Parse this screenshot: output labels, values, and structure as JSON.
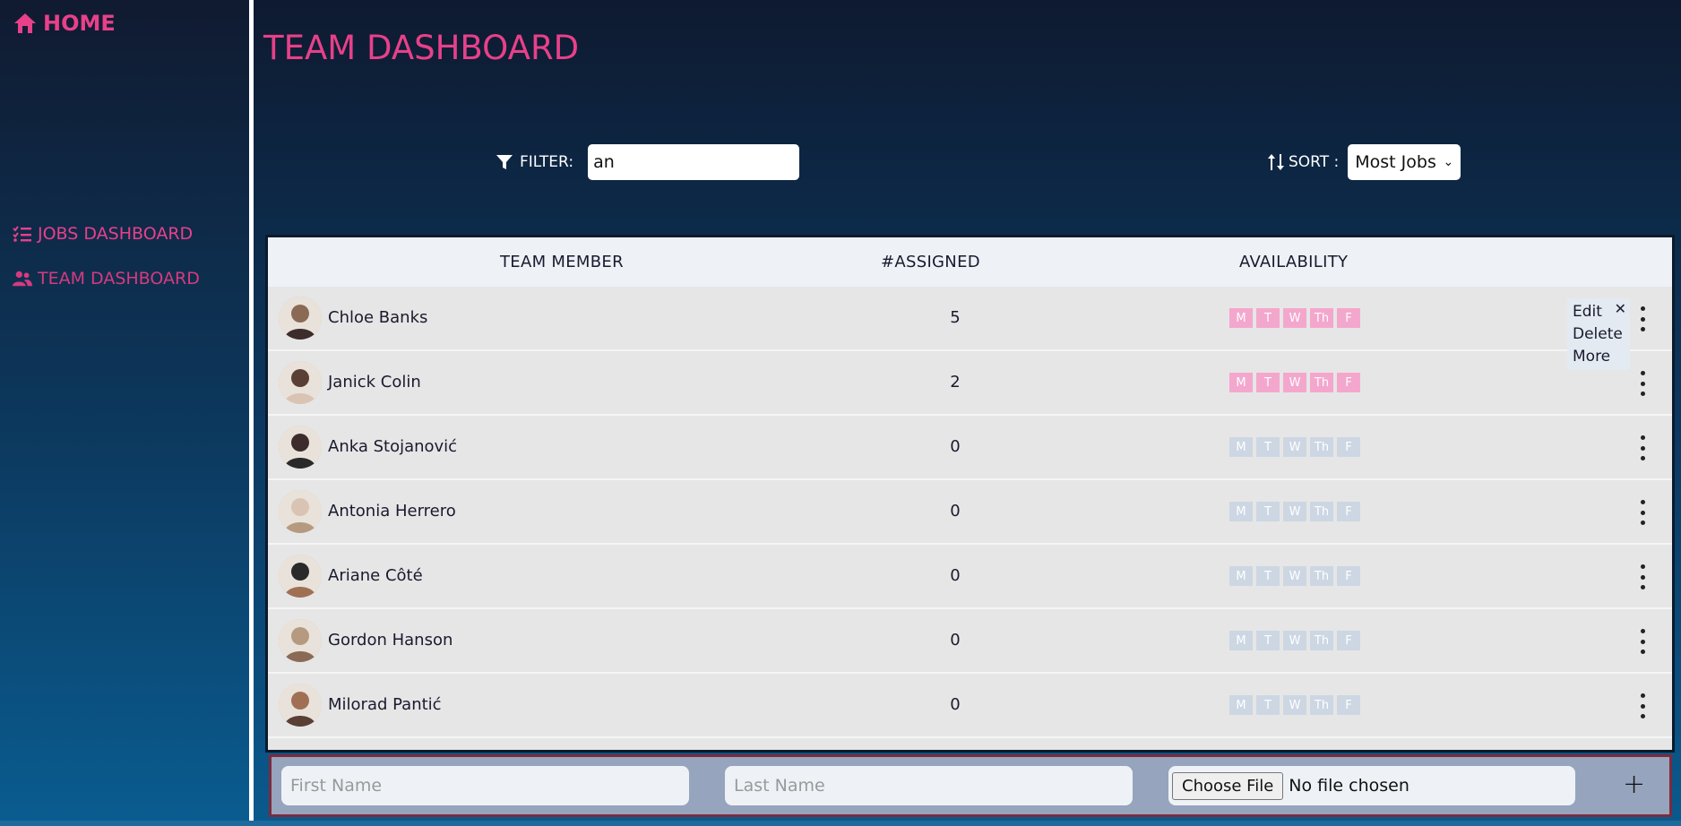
{
  "sidebar": {
    "home_label": "HOME",
    "nav": [
      {
        "label": "JOBS DASHBOARD",
        "icon": "list-check-icon"
      },
      {
        "label": "TEAM DASHBOARD",
        "icon": "users-icon"
      }
    ]
  },
  "header": {
    "title": "TEAM DASHBOARD",
    "filter_label": "FILTER:",
    "filter_value": "an",
    "sort_label": "SORT :",
    "sort_value": "Most Jobs"
  },
  "table": {
    "columns": [
      "TEAM MEMBER",
      "#ASSIGNED",
      "AVAILABILITY"
    ],
    "day_labels": [
      "M",
      "T",
      "W",
      "Th",
      "F"
    ],
    "rows": [
      {
        "name": "Chloe Banks",
        "assigned": "5",
        "available": true
      },
      {
        "name": "Janick Colin",
        "assigned": "2",
        "available": true
      },
      {
        "name": "Anka Stojanović",
        "assigned": "0",
        "available": false
      },
      {
        "name": "Antonia Herrero",
        "assigned": "0",
        "available": false
      },
      {
        "name": "Ariane Côté",
        "assigned": "0",
        "available": false
      },
      {
        "name": "Gordon Hanson",
        "assigned": "0",
        "available": false
      },
      {
        "name": "Milorad Pantić",
        "assigned": "0",
        "available": false
      }
    ],
    "row_menu": {
      "items": [
        "Edit",
        "Delete",
        "More"
      ],
      "close": "✕"
    }
  },
  "add_bar": {
    "first_name_placeholder": "First Name",
    "last_name_placeholder": "Last Name",
    "choose_file_label": "Choose File",
    "no_file_label": "No file chosen",
    "add_label": "+"
  },
  "colors": {
    "accent": "#e8408a",
    "day_on": "#f4a7cc",
    "day_off": "#cdd7e3"
  }
}
